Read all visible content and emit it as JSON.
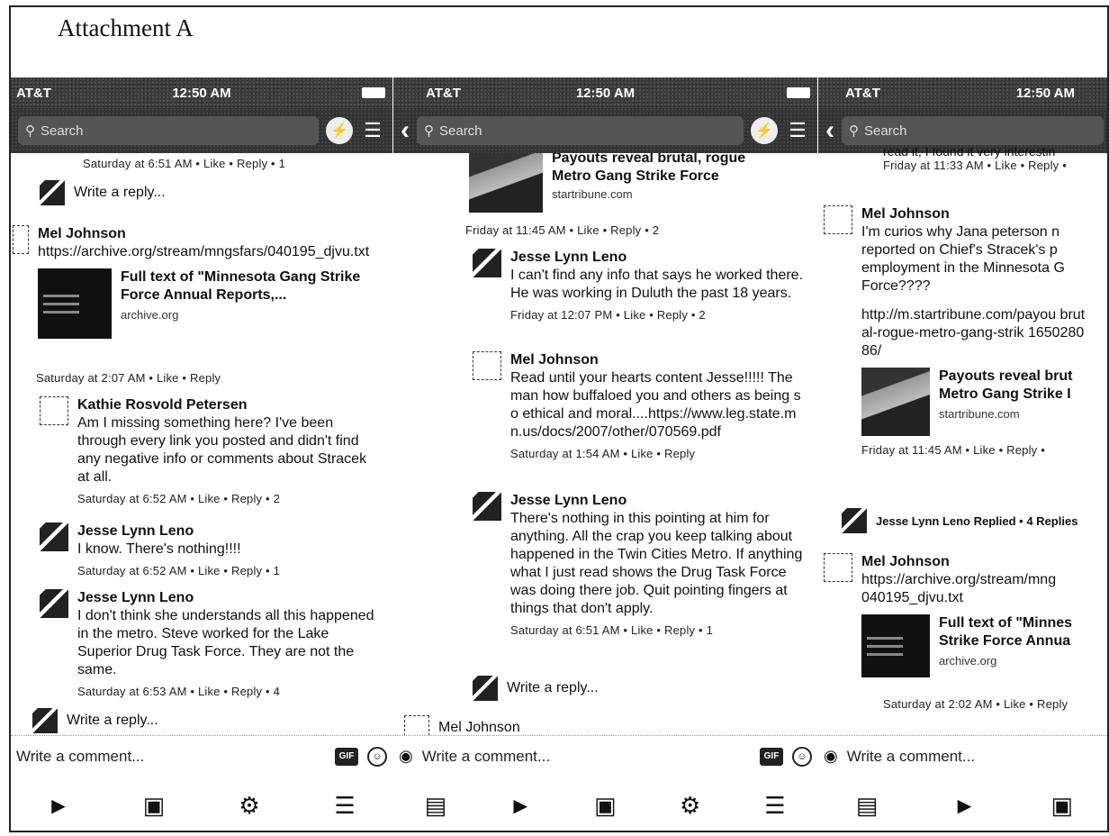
{
  "title": "Attachment A",
  "status": {
    "carrier": "AT&T",
    "time": "12:50 AM"
  },
  "search_placeholder": "Search",
  "composer": {
    "placeholder": "Write a comment...",
    "gif": "GIF"
  },
  "phone1": {
    "top_meta": "Saturday at 6:51 AM • Like • Reply • 1",
    "write_reply": "Write a reply...",
    "c1": {
      "name": "Mel Johnson",
      "text": "https://archive.org/stream/mngsfars/040195_djvu.txt",
      "card_title": "Full text of \"Minnesota Gang Strike Force Annual Reports,...",
      "card_src": "archive.org",
      "meta": "Saturday at 2:07 AM • Like • Reply"
    },
    "c2": {
      "name": "Kathie Rosvold Petersen",
      "text": "Am I missing something here? I've been through every link you posted and didn't find any negative info or comments about Stracek at all.",
      "meta": "Saturday at 6:52 AM • Like • Reply • 2"
    },
    "c3": {
      "name": "Jesse Lynn Leno",
      "text": "I know. There's nothing!!!!",
      "meta": "Saturday at 6:52 AM • Like • Reply • 1"
    },
    "c4": {
      "name": "Jesse Lynn Leno",
      "text": "I don't think she understands all this happened in the metro. Steve worked for the Lake Superior Drug Task Force. They are not the same.",
      "meta": "Saturday at 6:53 AM • Like • Reply • 4"
    },
    "bottom_reply": "Write a reply..."
  },
  "phone2": {
    "card_title": "Payouts reveal brutal, rogue Metro Gang Strike Force",
    "card_src": "startribune.com",
    "card_meta": "Friday at 11:45 AM • Like • Reply • 2",
    "c1": {
      "name": "Jesse Lynn Leno",
      "text": "I can't find any info that says he worked there. He was working in Duluth the past 18 years.",
      "meta": "Friday at 12:07 PM • Like • Reply • 2"
    },
    "c2": {
      "name": "Mel Johnson",
      "text": "Read until your hearts content Jesse!!!!! The man how buffaloed you and others as being so ethical and moral....https://www.leg.state.mn.us/docs/2007/other/070569.pdf",
      "meta": "Saturday at 1:54 AM • Like • Reply"
    },
    "c3": {
      "name": "Jesse Lynn Leno",
      "text": "There's nothing in this pointing at him for anything. All the crap you keep talking about happened in the Twin Cities Metro. If anything what I just read shows the Drug Task Force was doing there job. Quit pointing fingers at things that don't apply.",
      "meta": "Saturday at 6:51 AM • Like • Reply • 1"
    },
    "write_reply": "Write a reply...",
    "bottom_name": "Mel Johnson"
  },
  "phone3": {
    "top_text": "read it, I found it very interestin",
    "top_meta": "Friday at 11:33 AM • Like • Reply •",
    "c1": {
      "name": "Mel Johnson",
      "text": "I'm curios why Jana peterson n reported on Chief's Stracek's p employment in the Minnesota G Force????",
      "link": "http://m.startribune.com/payou brutal-rogue-metro-gang-strik 165028086/",
      "card_title": "Payouts reveal brut Metro Gang Strike I",
      "card_src": "startribune.com",
      "meta": "Friday at 11:45 AM • Like • Reply •"
    },
    "replied": "Jesse Lynn Leno Replied • 4 Replies",
    "c2": {
      "name": "Mel Johnson",
      "text": "https://archive.org/stream/mng 040195_djvu.txt",
      "card_title": "Full text of \"Minnes Strike Force Annua",
      "card_src": "archive.org",
      "meta": "Saturday at 2:02 AM • Like • Reply"
    }
  }
}
